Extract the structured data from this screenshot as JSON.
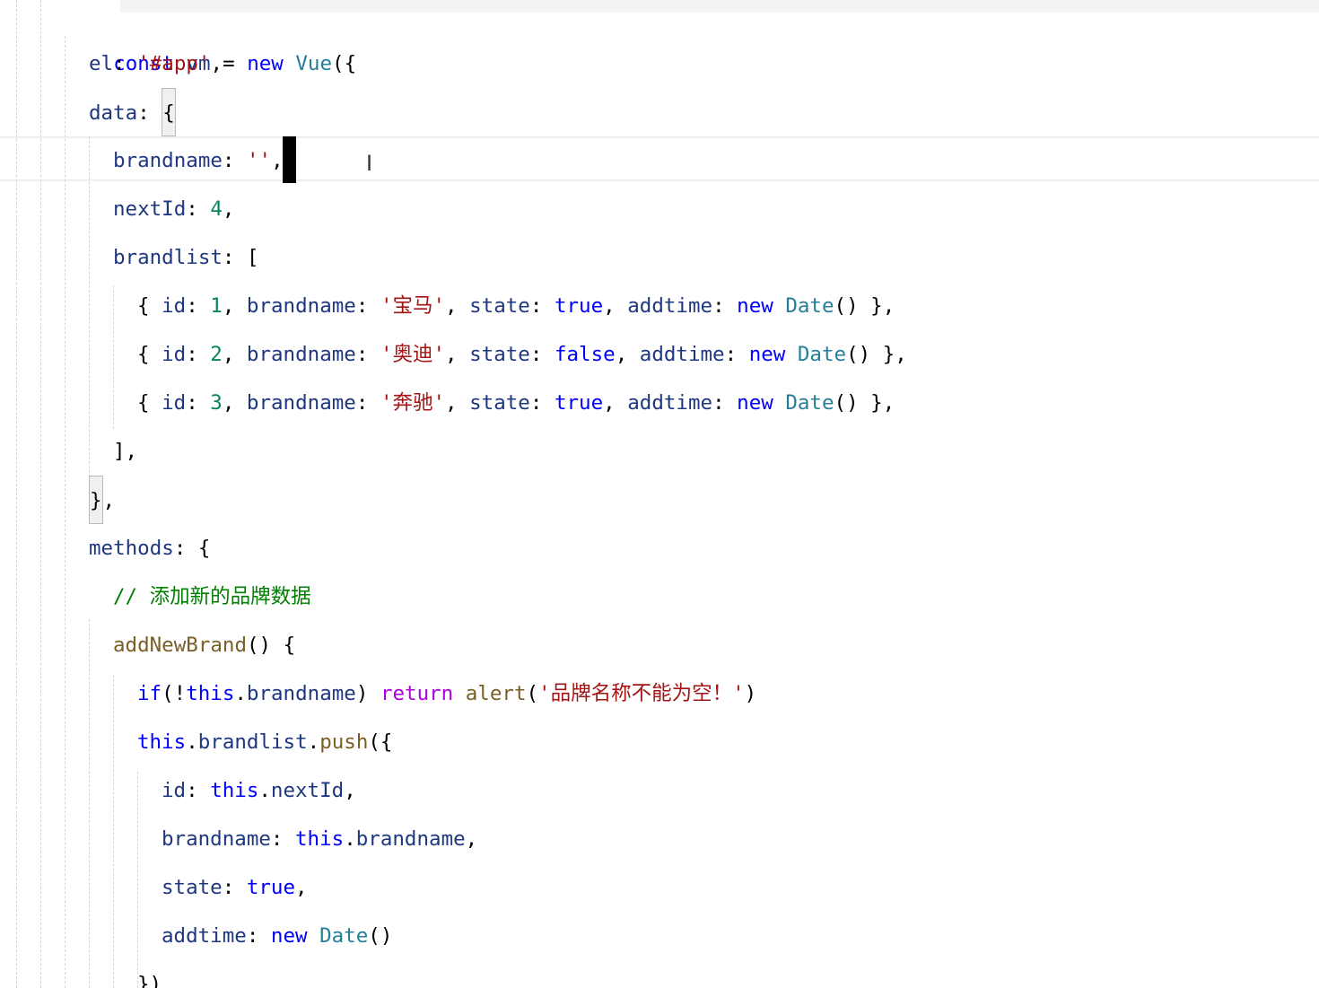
{
  "code": {
    "line0": {
      "kw1": "const",
      "var": "vm",
      "eq": " = ",
      "kw2": "new",
      "cls": "Vue",
      "punc": "({"
    },
    "line1": {
      "key": "el",
      "colon": ": ",
      "str": "'#app'",
      "punc": ","
    },
    "line2": {
      "key": "data",
      "colon": ": ",
      "brace": "{"
    },
    "line3": {
      "key": "brandname",
      "colon": ": ",
      "str": "''",
      "punc": ","
    },
    "line4": {
      "key": "nextId",
      "colon": ": ",
      "num": "4",
      "punc": ","
    },
    "line5": {
      "key": "brandlist",
      "colon": ": ",
      "bracket": "["
    },
    "rows": [
      {
        "open": "{ ",
        "k_id": "id",
        "c1": ": ",
        "id": "1",
        "s1": ", ",
        "k_name": "brandname",
        "c2": ": ",
        "name": "'宝马'",
        "s2": ", ",
        "k_state": "state",
        "c3": ": ",
        "state": "true",
        "s3": ", ",
        "k_time": "addtime",
        "c4": ": ",
        "kw_new": "new",
        "sp": " ",
        "cls": "Date",
        "close": "() },"
      },
      {
        "open": "{ ",
        "k_id": "id",
        "c1": ": ",
        "id": "2",
        "s1": ", ",
        "k_name": "brandname",
        "c2": ": ",
        "name": "'奥迪'",
        "s2": ", ",
        "k_state": "state",
        "c3": ": ",
        "state": "false",
        "s3": ", ",
        "k_time": "addtime",
        "c4": ": ",
        "kw_new": "new",
        "sp": " ",
        "cls": "Date",
        "close": "() },"
      },
      {
        "open": "{ ",
        "k_id": "id",
        "c1": ": ",
        "id": "3",
        "s1": ", ",
        "k_name": "brandname",
        "c2": ": ",
        "name": "'奔驰'",
        "s2": ", ",
        "k_state": "state",
        "c3": ": ",
        "state": "true",
        "s3": ", ",
        "k_time": "addtime",
        "c4": ": ",
        "kw_new": "new",
        "sp": " ",
        "cls": "Date",
        "close": "() },"
      }
    ],
    "line9": {
      "text": "],"
    },
    "line10": {
      "brace": "}",
      "punc": ","
    },
    "line11": {
      "key": "methods",
      "colon": ": ",
      "brace": "{"
    },
    "line12": {
      "comment": "// 添加新的品牌数据"
    },
    "line13": {
      "fn": "addNewBrand",
      "punc": "() {"
    },
    "line14": {
      "kw_if": "if",
      "p1": "(!",
      "kw_this": "this",
      "p2": ".",
      "prop": "brandname",
      "p3": ") ",
      "kw_return": "return",
      "sp": " ",
      "fn": "alert",
      "p4": "(",
      "str": "'品牌名称不能为空！'",
      "p5": ")"
    },
    "line15": {
      "kw_this": "this",
      "p1": ".",
      "prop": "brandlist",
      "p2": ".",
      "fn": "push",
      "p3": "({"
    },
    "line16": {
      "key": "id",
      "colon": ": ",
      "kw_this": "this",
      "p1": ".",
      "prop": "nextId",
      "p2": ","
    },
    "line17": {
      "key": "brandname",
      "colon": ": ",
      "kw_this": "this",
      "p1": ".",
      "prop": "brandname",
      "p2": ","
    },
    "line18": {
      "key": "state",
      "colon": ": ",
      "val": "true",
      "p1": ","
    },
    "line19": {
      "key": "addtime",
      "colon": ": ",
      "kw_new": "new",
      "sp": " ",
      "cls": "Date",
      "p1": "()"
    },
    "line20": {
      "text": "})"
    }
  },
  "cursor": {
    "mouse_icon": "i-beam-cursor-icon",
    "mouse_glyph": "I"
  },
  "colors": {
    "property": "#1f377f",
    "string": "#a31515",
    "number": "#098658",
    "keyword": "#0000ff",
    "control": "#af00db",
    "type": "#267f99",
    "function": "#795e26",
    "comment": "#008000"
  }
}
